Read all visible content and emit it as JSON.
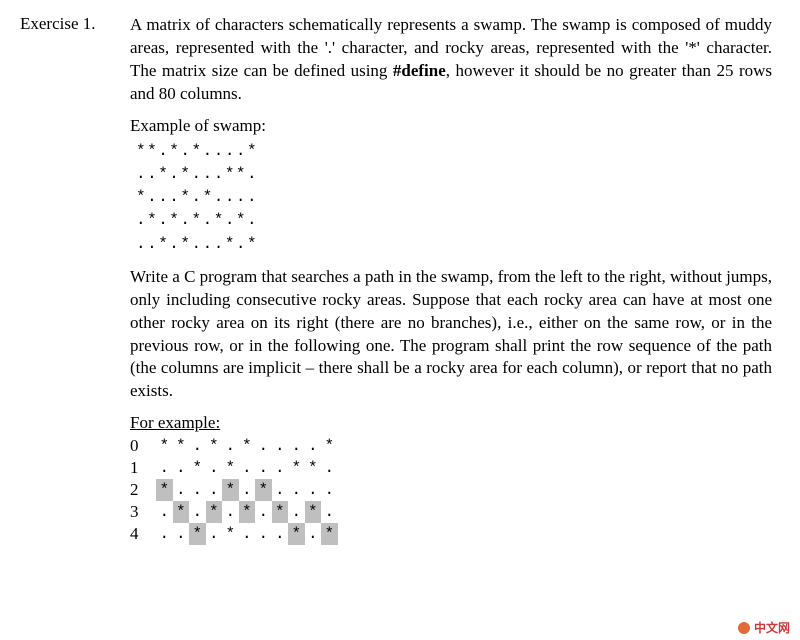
{
  "exercise_label": "Exercise 1.",
  "para1_pre": "A matrix of characters schematically represents a swamp. The swamp is composed of muddy areas, represented with the '.' character, and rocky areas, represented with the '*' character. The matrix size can be defined using ",
  "para1_define": "#define",
  "para1_post": ", however it should be no greater than 25 rows and 80 columns.",
  "example_label": "Example of swamp:",
  "swamp_code": "**.*.*....*\n..*.*...**.\n*...*.*....\n.*.*.*.*.*.\n..*.*...*.*",
  "para2": "Write a C program that searches a path in the swamp, from the left to the right, without jumps, only including consecutive rocky areas. Suppose that each rocky area can have at most one other rocky area on its right (there are no branches), i.e., either on the same row, or in the previous row, or in the following one. The program shall print the row sequence of the path (the columns are implicit – there shall be a rocky area for each column), or report that no path exists.",
  "for_example_label": "For example:",
  "chart_data": {
    "type": "table",
    "title": "Path example grid",
    "rows": 5,
    "cols": 11,
    "row_labels": [
      "0",
      "1",
      "2",
      "3",
      "4"
    ],
    "grid": [
      "**.*.*....*",
      "..*.*...**.",
      "*...*.*....",
      ".*.*.*.*.*.",
      "..*.*...*.*"
    ],
    "highlight": [
      [
        false,
        false,
        false,
        false,
        false,
        false,
        false,
        false,
        false,
        false,
        false
      ],
      [
        false,
        false,
        false,
        false,
        false,
        false,
        false,
        false,
        false,
        false,
        false
      ],
      [
        true,
        false,
        false,
        false,
        true,
        false,
        true,
        false,
        false,
        false,
        false
      ],
      [
        false,
        true,
        false,
        true,
        false,
        true,
        false,
        true,
        false,
        true,
        false
      ],
      [
        false,
        false,
        true,
        false,
        false,
        false,
        false,
        false,
        true,
        false,
        true
      ]
    ]
  },
  "watermark_text": "中文网"
}
